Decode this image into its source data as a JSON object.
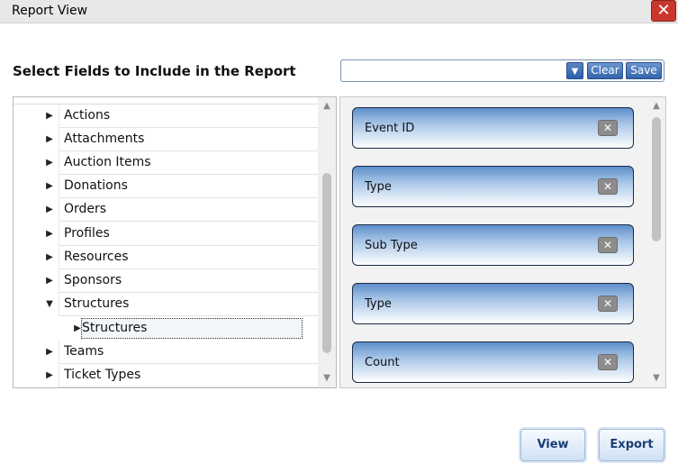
{
  "window": {
    "title": "Report View",
    "close_icon": "close-icon"
  },
  "heading": "Select Fields to Include in the Report",
  "template_select": {
    "value": "",
    "clear_label": "Clear",
    "save_label": "Save"
  },
  "tree": {
    "items": [
      {
        "label": "Actions",
        "expanded": false
      },
      {
        "label": "Attachments",
        "expanded": false
      },
      {
        "label": "Auction Items",
        "expanded": false
      },
      {
        "label": "Donations",
        "expanded": false
      },
      {
        "label": "Orders",
        "expanded": false
      },
      {
        "label": "Profiles",
        "expanded": false
      },
      {
        "label": "Resources",
        "expanded": false
      },
      {
        "label": "Sponsors",
        "expanded": false
      },
      {
        "label": "Structures",
        "expanded": true
      },
      {
        "label": "Teams",
        "expanded": false
      },
      {
        "label": "Ticket Types",
        "expanded": false
      }
    ],
    "child": {
      "label": "Structures",
      "selected": true
    }
  },
  "selected_fields": [
    {
      "label": "Event ID"
    },
    {
      "label": "Type"
    },
    {
      "label": "Sub Type"
    },
    {
      "label": "Type"
    },
    {
      "label": "Count"
    }
  ],
  "buttons": {
    "view": "View",
    "export": "Export"
  },
  "colors": {
    "accent": "#3464ad",
    "close": "#c9372c"
  }
}
